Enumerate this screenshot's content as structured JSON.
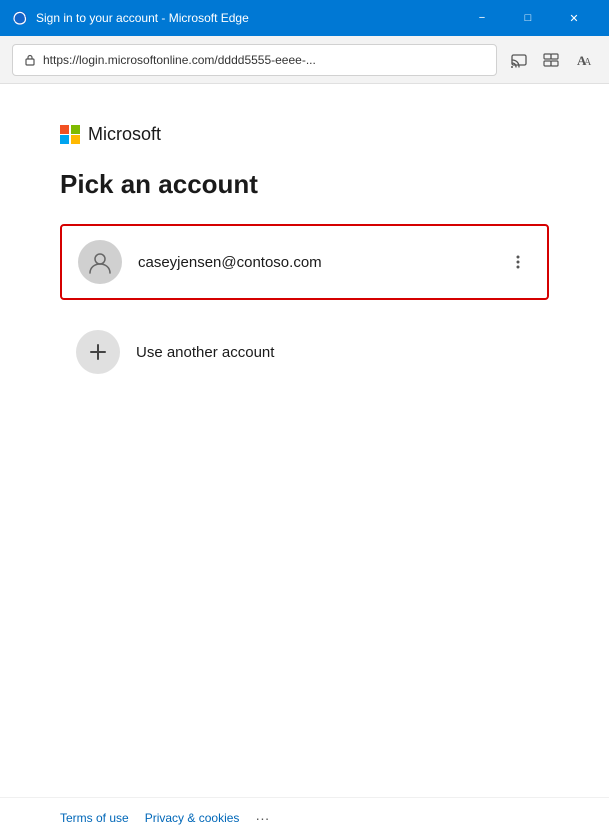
{
  "titlebar": {
    "title": "Sign in to your account - Microsoft Edge",
    "minimize_label": "−",
    "maximize_label": "□",
    "close_label": "✕"
  },
  "addressbar": {
    "url": "https://login.microsoftonline.com/dddd5555-eeee-...",
    "lock_icon": "lock"
  },
  "ms_logo": {
    "name": "Microsoft"
  },
  "page": {
    "title": "Pick an account"
  },
  "accounts": [
    {
      "email": "caseyjensen@contoso.com",
      "selected": true
    }
  ],
  "other_account": {
    "label": "Use another account"
  },
  "footer": {
    "terms_label": "Terms of use",
    "privacy_label": "Privacy & cookies",
    "more_label": "···"
  }
}
